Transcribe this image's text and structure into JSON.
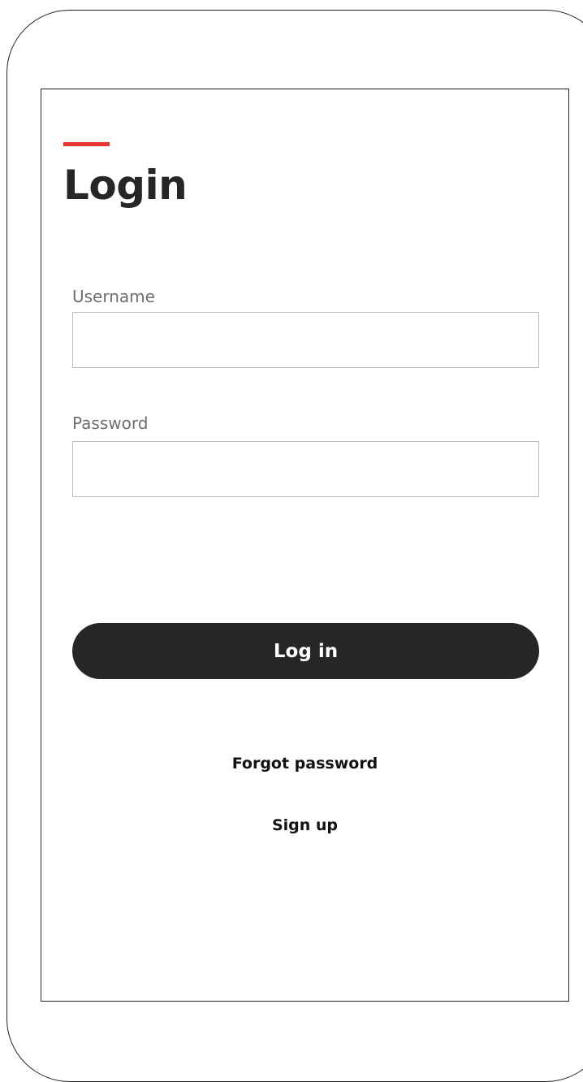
{
  "login": {
    "title": "Login",
    "username": {
      "label": "Username",
      "value": "",
      "placeholder": ""
    },
    "password": {
      "label": "Password",
      "value": "",
      "placeholder": ""
    },
    "submit_label": "Log in",
    "forgot_password_label": "Forgot password",
    "sign_up_label": "Sign up"
  },
  "colors": {
    "accent": "#e8342c",
    "button_background": "#262626",
    "button_text": "#ffffff",
    "title_text": "#262626",
    "label_text": "#6e6e6e",
    "input_border": "#bdbdbd"
  }
}
